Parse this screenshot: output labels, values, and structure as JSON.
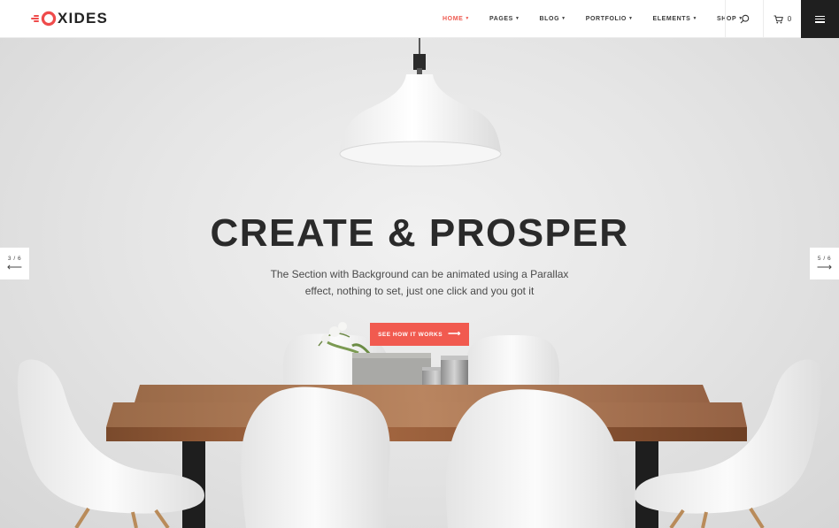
{
  "brand": {
    "name": "OXIDES",
    "text_after_mark": "XIDES",
    "logo_icon": "speed-o-mark",
    "accent_color": "#ef4b4b"
  },
  "nav": {
    "items": [
      {
        "label": "HOME",
        "active": true
      },
      {
        "label": "PAGES",
        "active": false
      },
      {
        "label": "BLOG",
        "active": false
      },
      {
        "label": "PORTFOLIO",
        "active": false
      },
      {
        "label": "ELEMENTS",
        "active": false
      },
      {
        "label": "SHOP",
        "active": false
      }
    ],
    "caret_icon": "chevron-down-icon",
    "active_color": "#ef5a50"
  },
  "header_tools": {
    "search_icon": "search-icon",
    "cart_icon": "cart-icon",
    "cart_count": "0",
    "menu_icon": "hamburger-icon",
    "menu_bg": "#1f1f1f"
  },
  "hero": {
    "headline": "CREATE & PROSPER",
    "subtext_line1": "The Section with Background can be animated using a Parallax",
    "subtext_line2": "effect, nothing to set, just one click and you got it",
    "cta_label": "SEE HOW IT WORKS",
    "cta_color": "#f15a4f",
    "cta_icon": "arrow-right-icon"
  },
  "slider": {
    "prev_label": "3 / 6",
    "next_label": "5 / 6",
    "prev_icon": "arrow-left-icon",
    "next_icon": "arrow-right-icon"
  }
}
